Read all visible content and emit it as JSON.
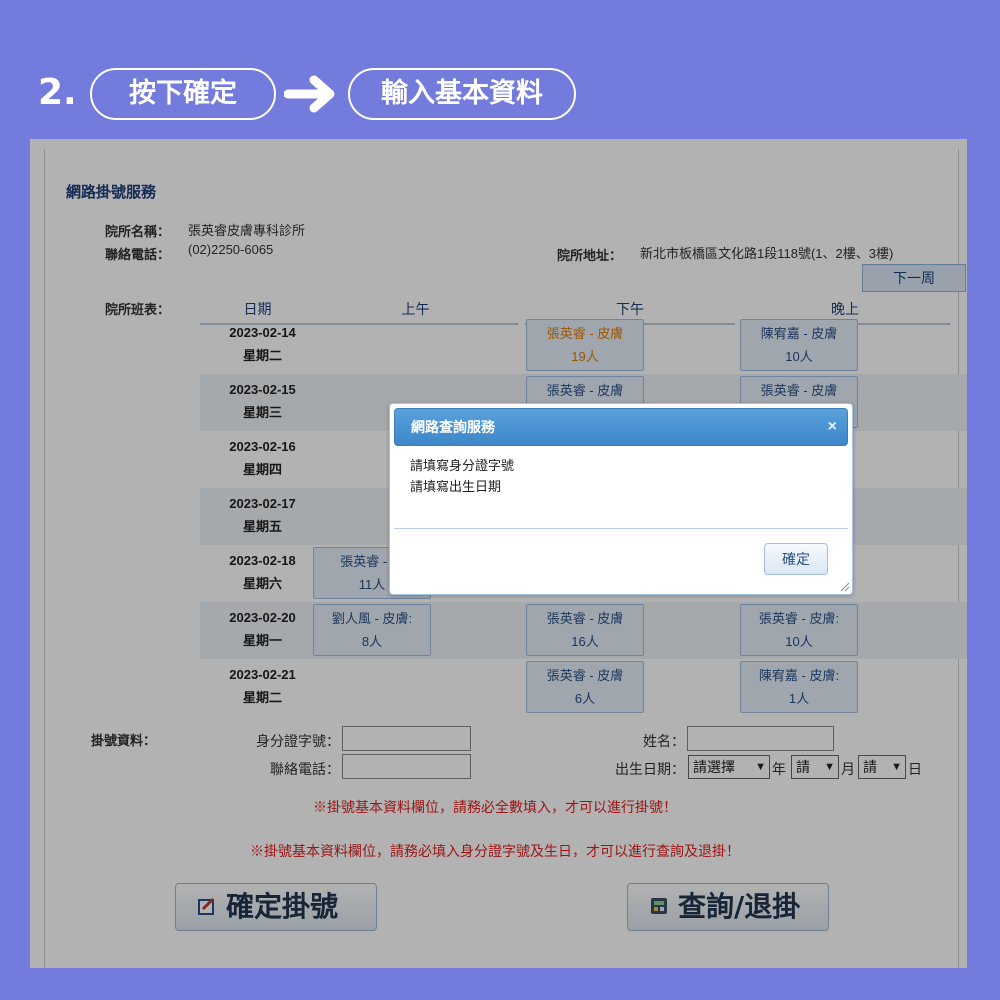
{
  "step": {
    "number": "2.",
    "action_label": "按下確定",
    "result_label": "輸入基本資料",
    "arrow_icon": "arrow-right-icon"
  },
  "page": {
    "service_title": "網路掛號服務",
    "clinic_name_label": "院所名稱：",
    "clinic_name": "張英睿皮膚專科診所",
    "phone_label": "聯絡電話：",
    "phone": "(02)2250-6065",
    "address_label": "院所地址：",
    "address": "新北市板橋區文化路1段118號(1、2樓、3樓)",
    "next_week": "下一周",
    "schedule_label": "院所班表：",
    "columns": [
      "日期",
      "上午",
      "下午",
      "晚上"
    ],
    "rows": [
      {
        "date": "2023-02-14",
        "weekday": "星期二",
        "am": null,
        "pm": {
          "doctor": "張英睿 - 皮膚",
          "count": "19人",
          "highlight": true
        },
        "eve": {
          "doctor": "陳宥嘉 - 皮膚",
          "count": "10人"
        }
      },
      {
        "date": "2023-02-15",
        "weekday": "星期三",
        "am": null,
        "pm": {
          "doctor": "張英睿 - 皮膚",
          "count": ""
        },
        "eve": {
          "doctor": "張英睿 - 皮膚",
          "count": ""
        }
      },
      {
        "date": "2023-02-16",
        "weekday": "星期四",
        "am": null,
        "pm": null,
        "eve": null
      },
      {
        "date": "2023-02-17",
        "weekday": "星期五",
        "am": null,
        "pm": null,
        "eve": null
      },
      {
        "date": "2023-02-18",
        "weekday": "星期六",
        "am": {
          "doctor": "張英睿 - 皮",
          "count": "11人"
        },
        "pm": null,
        "eve": null
      },
      {
        "date": "2023-02-20",
        "weekday": "星期一",
        "am": {
          "doctor": "劉人風 - 皮膚:",
          "count": "8人"
        },
        "pm": {
          "doctor": "張英睿 - 皮膚",
          "count": "16人"
        },
        "eve": {
          "doctor": "張英睿 - 皮膚:",
          "count": "10人"
        }
      },
      {
        "date": "2023-02-21",
        "weekday": "星期二",
        "am": null,
        "pm": {
          "doctor": "張英睿 - 皮膚",
          "count": "6人"
        },
        "eve": {
          "doctor": "陳宥嘉 - 皮膚:",
          "count": "1人"
        }
      }
    ],
    "form": {
      "section_label": "掛號資料：",
      "id_label": "身分證字號：",
      "id_value": "",
      "name_label": "姓名：",
      "name_value": "",
      "phone_label": "聯絡電話：",
      "phone_value": "",
      "birth_label": "出生日期：",
      "year_select": "請選擇",
      "year_unit": "年",
      "month_select": "請",
      "month_unit": "月",
      "day_select": "請",
      "day_unit": "日"
    },
    "warning_1": "※掛號基本資料欄位，請務必全數填入，才可以進行掛號！",
    "warning_2": "※掛號基本資料欄位，請務必填入身分證字號及生日，才可以進行查詢及退掛！",
    "confirm_button": "確定掛號",
    "query_button": "查詢/退掛"
  },
  "dialog": {
    "title": "網路查詢服務",
    "close": "×",
    "messages": [
      "請填寫身分證字號",
      "請填寫出生日期"
    ],
    "ok_label": "確定"
  },
  "colors": {
    "background": "#737BDD",
    "dialog_header": "#3d87c9",
    "warning": "#e02020",
    "highlight_slot": "#e07b00"
  }
}
